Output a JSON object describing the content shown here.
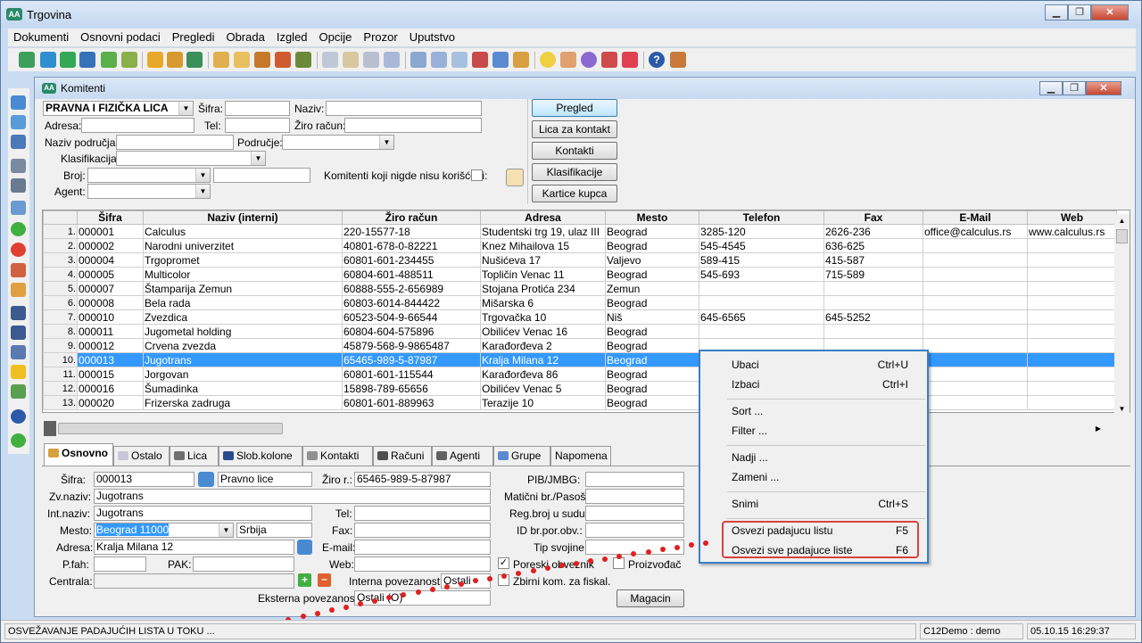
{
  "window": {
    "title": "Trgovina",
    "logo": "AA"
  },
  "menu": [
    "Dokumenti",
    "Osnovni podaci",
    "Pregledi",
    "Obrada",
    "Izgled",
    "Opcije",
    "Prozor",
    "Uputstvo"
  ],
  "child": {
    "title": "Komitenti",
    "logo": "AA"
  },
  "filter": {
    "type_value": "PRAVNA I FIZIČKA LICA",
    "sifra_label": "Šifra:",
    "naziv_label": "Naziv:",
    "adresa_label": "Adresa:",
    "tel_label": "Tel:",
    "ziro_label": "Žiro račun:",
    "naziv_podrucja_label": "Naziv područja:",
    "podrucje_label": "Područje:",
    "klasifikacija_label": "Klasifikacija:",
    "broj_label": "Broj:",
    "agent_label": "Agent:",
    "unused_label": "Komitenti koji nigde nisu korišćeni:"
  },
  "buttons": {
    "pregled": "Pregled",
    "lica": "Lica za kontakt",
    "kontakti": "Kontakti",
    "klasifikacije": "Klasifikacije",
    "kartice": "Kartice kupca"
  },
  "grid": {
    "columns": [
      "Šifra",
      "Naziv (interni)",
      "Žiro račun",
      "Adresa",
      "Mesto",
      "Telefon",
      "Fax",
      "E-Mail",
      "Web"
    ],
    "rows": [
      [
        "1.",
        "000001",
        "Calculus",
        "220-15577-18",
        "Studentski trg 19, ulaz III",
        "Beograd",
        "3285-120",
        "2626-236",
        "office@calculus.rs",
        "www.calculus.rs"
      ],
      [
        "2.",
        "000002",
        "Narodni univerzitet",
        "40801-678-0-82221",
        "Knez Mihailova 15",
        "Beograd",
        "545-4545",
        "636-625",
        "",
        ""
      ],
      [
        "3.",
        "000004",
        "Trgopromet",
        "60801-601-234455",
        "Nušićeva 17",
        "Valjevo",
        "589-415",
        "415-587",
        "",
        ""
      ],
      [
        "4.",
        "000005",
        "Multicolor",
        "60804-601-488511",
        "Topličin Venac 11",
        "Beograd",
        "545-693",
        "715-589",
        "",
        ""
      ],
      [
        "5.",
        "000007",
        "Štamparija Zemun",
        "60888-555-2-656989",
        "Stojana Protića 234",
        "Zemun",
        "",
        "",
        "",
        ""
      ],
      [
        "6.",
        "000008",
        "Bela rada",
        "60803-6014-844422",
        "Mišarska 6",
        "Beograd",
        "",
        "",
        "",
        ""
      ],
      [
        "7.",
        "000010",
        "Zvezdica",
        "60523-504-9-66544",
        "Trgovačka 10",
        "Niš",
        "645-6565",
        "645-5252",
        "",
        ""
      ],
      [
        "8.",
        "000011",
        "Jugometal holding",
        "60804-604-575896",
        "Obilićev Venac 16",
        "Beograd",
        "",
        "",
        "",
        ""
      ],
      [
        "9.",
        "000012",
        "Crvena zvezda",
        "45879-568-9-9865487",
        "Karađorđeva 2",
        "Beograd",
        "",
        "",
        "",
        ""
      ],
      [
        "10.",
        "000013",
        "Jugotrans",
        "65465-989-5-87987",
        "Kralja Milana 12",
        "Beograd",
        "",
        "",
        "",
        ""
      ],
      [
        "11.",
        "000015",
        "Jorgovan",
        "60801-601-115544",
        "Karađorđeva 86",
        "Beograd",
        "",
        "",
        "",
        ""
      ],
      [
        "12.",
        "000016",
        "Šumadinka",
        "15898-789-65656",
        "Obilićev Venac 5",
        "Beograd",
        "",
        "",
        "",
        ""
      ],
      [
        "13.",
        "000020",
        "Frizerska zadruga",
        "60801-601-889963",
        "Terazije 10",
        "Beograd",
        "",
        "",
        "",
        ""
      ]
    ],
    "selected_index": 9
  },
  "tabs": [
    "Osnovno",
    "Ostalo",
    "Lica",
    "Slob.kolone",
    "Kontakti",
    "Računi",
    "Agenti",
    "Grupe",
    "Napomena"
  ],
  "detail": {
    "sifra_label": "Šifra:",
    "sifra": "000013",
    "vrsta": "Pravno lice",
    "ziro_label": "Žiro r.:",
    "ziro": "65465-989-5-87987",
    "zvnaziv_label": "Zv.naziv:",
    "zvnaziv": "Jugotrans",
    "intnaziv_label": "Int.naziv:",
    "intnaziv": "Jugotrans",
    "mesto_label": "Mesto:",
    "mesto": "Beograd  11000",
    "drzava": "Srbija",
    "adresa_label": "Adresa:",
    "adresa": "Kralja Milana 12",
    "pfah_label": "P.fah:",
    "pak_label": "PAK:",
    "centrala_label": "Centrala:",
    "tel_label": "Tel:",
    "fax_label": "Fax:",
    "email_label": "E-mail:",
    "web_label": "Web:",
    "pib_label": "PIB/JMBG:",
    "maticni_label": "Matični br./Pasoš:",
    "regbroj_label": "Reg.broj u sudu:",
    "idbr_label": "ID br.por.obv.:",
    "tip_label": "Tip svojine:",
    "poreski": "Poreski obveznik",
    "proizvodjac": "Proizvođač",
    "zbirni": "Zbirni kom. za fiskal.",
    "interna_label": "Interna povezanost:",
    "interna": "Ostali",
    "eksterna_label": "Eksterna povezanost:",
    "eksterna": "Ostali (O)",
    "magacin": "Magacin"
  },
  "context_menu": [
    {
      "label": "Ubaci",
      "shortcut": "Ctrl+U"
    },
    {
      "label": "Izbaci",
      "shortcut": "Ctrl+I"
    },
    {
      "label": "Sort ...",
      "shortcut": ""
    },
    {
      "label": "Filter ...",
      "shortcut": ""
    },
    {
      "label": "Nadji ...",
      "shortcut": ""
    },
    {
      "label": "Zameni ...",
      "shortcut": ""
    },
    {
      "label": "Snimi",
      "shortcut": "Ctrl+S"
    },
    {
      "label": "Osvezi padajucu listu",
      "shortcut": "F5"
    },
    {
      "label": "Osvezi sve padajuce liste",
      "shortcut": "F6"
    }
  ],
  "status": {
    "message": "OSVEŽAVANJE PADAJUĆIH LISTA U TOKU ...",
    "user": "C12Demo : demo",
    "datetime": "05.10.15 16:29:37"
  },
  "colors": {
    "selection": "#3399ff",
    "highlight_box": "#d8433c",
    "menu_border": "#3a7fc8"
  }
}
